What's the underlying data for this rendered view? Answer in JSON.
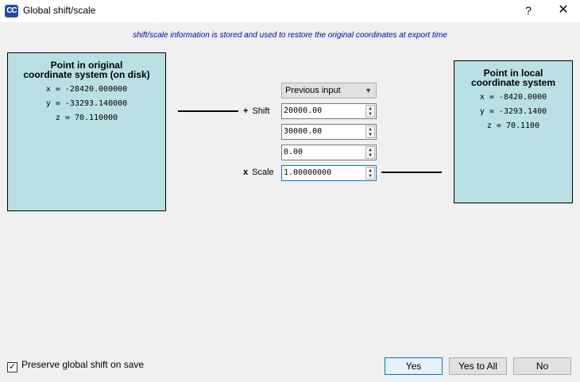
{
  "window": {
    "app_icon": "CC",
    "title": "Global shift/scale",
    "help": "?",
    "close": "✕"
  },
  "info": "shift/scale information is stored and used to restore the original coordinates at export time",
  "original": {
    "heading_line1": "Point in original",
    "heading_line2": "coordinate system (on disk)",
    "x": "x = -28420.000000",
    "y": "y = -33293.140000",
    "z": "z = 70.110000"
  },
  "local": {
    "heading_line1": "Point in local",
    "heading_line2": "coordinate system",
    "x": "x = -8420.0000",
    "y": "y = -3293.1400",
    "z": "z = 70.1100"
  },
  "shift": {
    "preset": "Previous input",
    "label_sign": "+",
    "label": "Shift",
    "x": "20000.00",
    "y": "30000.00",
    "z": "0.00"
  },
  "scale": {
    "label_sign": "x",
    "label": "Scale",
    "value": "1.00000000"
  },
  "preserve": {
    "checked_mark": "✓",
    "label": "Preserve global shift on save"
  },
  "buttons": {
    "yes": "Yes",
    "yes_to_all": "Yes to All",
    "no": "No"
  },
  "icons": {
    "spin_up": "▲",
    "spin_down": "▼",
    "combo_arrow": "▼"
  }
}
